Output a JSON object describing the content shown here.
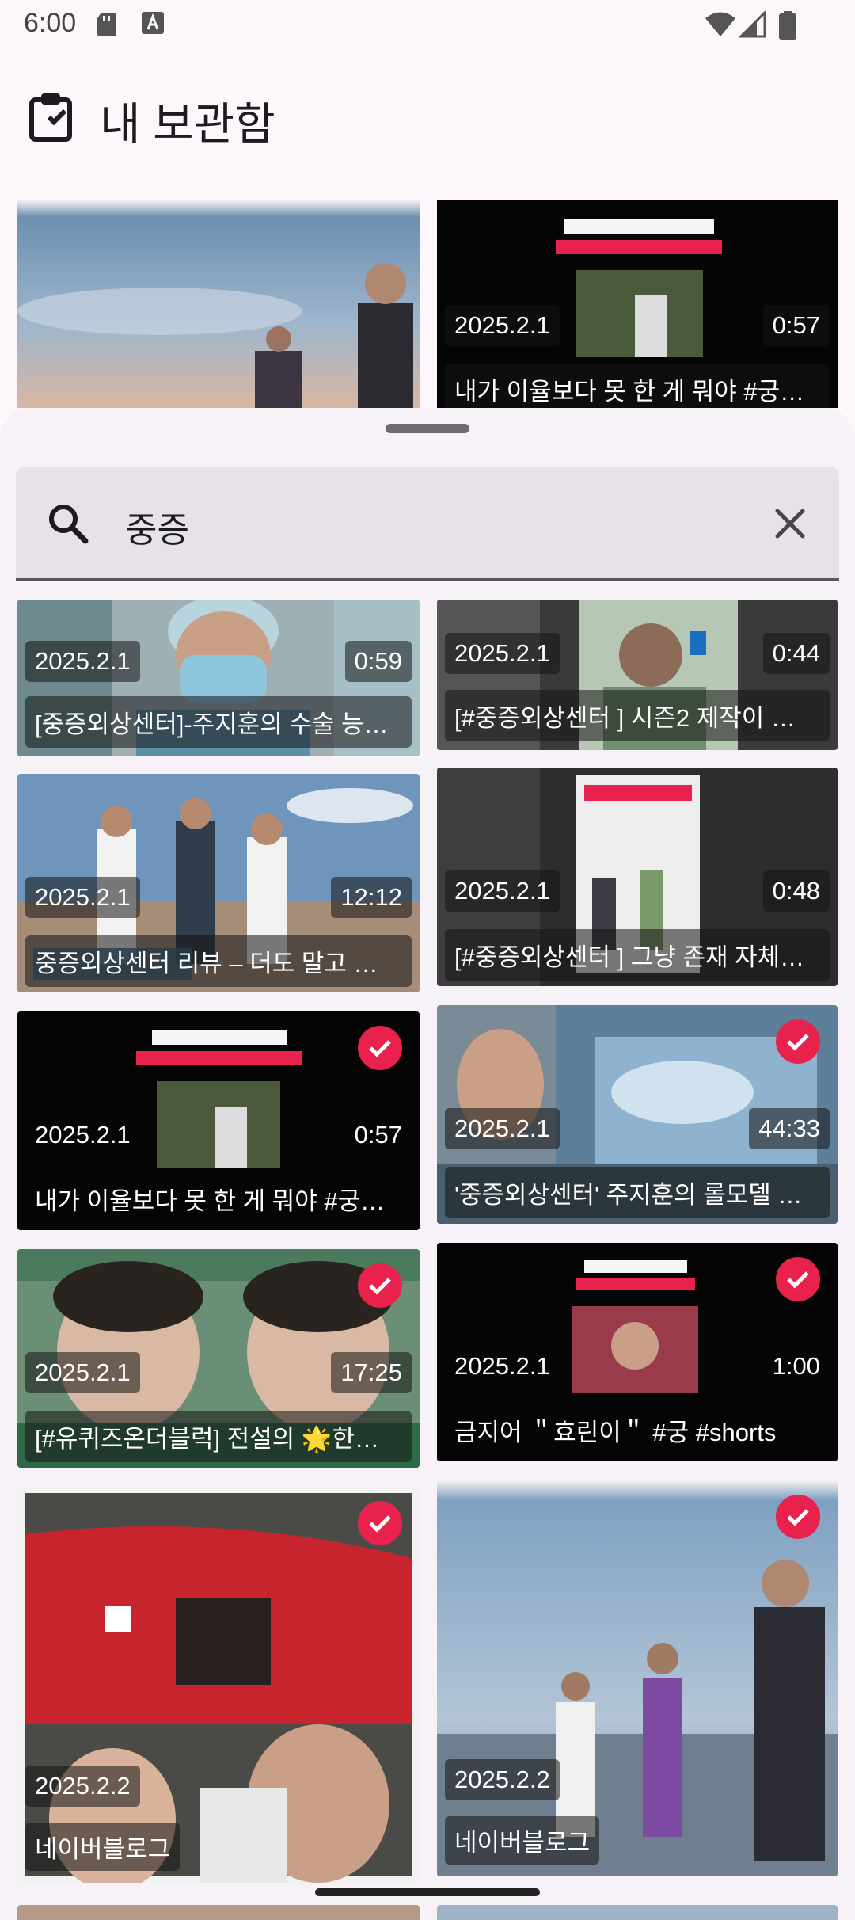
{
  "status": {
    "time": "6:00"
  },
  "header": {
    "title": "내 보관함"
  },
  "background_cards": [
    {
      "date": "",
      "duration": "",
      "title": ""
    },
    {
      "date": "2025.2.1",
      "duration": "0:57",
      "title": "내가 이율보다 못 한 게 뭐야 #궁…"
    }
  ],
  "search": {
    "query": "중증"
  },
  "results": [
    {
      "date": "2025.2.1",
      "duration": "0:59",
      "title": "[중증외상센터]-주지훈의 수술 능…",
      "checked": false
    },
    {
      "date": "2025.2.1",
      "duration": "0:44",
      "title": "[#중증외상센터 ] 시즌2 제작이 …",
      "checked": false
    },
    {
      "date": "2025.2.1",
      "duration": "12:12",
      "title": "중증외상센터 리뷰 – 더도 말고 …",
      "checked": false
    },
    {
      "date": "2025.2.1",
      "duration": "0:48",
      "title": "[#중증외상센터 ] 그냥 존재 자체…",
      "checked": false
    },
    {
      "date": "2025.2.1",
      "duration": "0:57",
      "title": "내가 이율보다 못 한 게 뭐야 #궁…",
      "checked": true
    },
    {
      "date": "2025.2.1",
      "duration": "44:33",
      "title": "'중증외상센터' 주지훈의 롤모델 …",
      "checked": true
    },
    {
      "date": "2025.2.1",
      "duration": "17:25",
      "title": "[#유퀴즈온더블럭] 전설의 🌟한…",
      "checked": true
    },
    {
      "date": "2025.2.1",
      "duration": "1:00",
      "title": "금지어 ＂효린이＂ #궁 #shorts",
      "checked": true
    },
    {
      "date": "2025.2.2",
      "duration": "",
      "title": "네이버블로그",
      "checked": true
    },
    {
      "date": "2025.2.2",
      "duration": "",
      "title": "네이버블로그",
      "checked": true
    }
  ],
  "colors": {
    "accent": "#e8224c",
    "background": "#fdf7fb",
    "sheet": "#f7f2f7"
  }
}
